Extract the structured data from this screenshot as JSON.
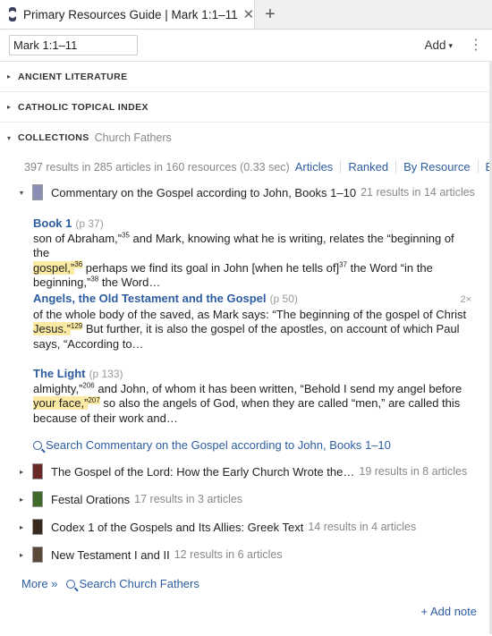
{
  "tab": {
    "title": "Primary Resources Guide | Mark 1:1–11",
    "close": "✕",
    "add": "+"
  },
  "toolbar": {
    "reference": "Mark 1:1–11",
    "add_label": "Add",
    "add_caret": "▾",
    "more": "⋮"
  },
  "sections": [
    {
      "title": "ANCIENT LITERATURE",
      "sub": "",
      "arrow": "▸"
    },
    {
      "title": "CATHOLIC TOPICAL INDEX",
      "sub": "",
      "arrow": "▸"
    },
    {
      "title": "COLLECTIONS",
      "sub": "Church Fathers",
      "arrow": "▾"
    }
  ],
  "results": {
    "count": "397 results in 285 articles in 160 resources (0.33 sec)",
    "views": [
      "Articles",
      "Ranked",
      "By Resource",
      "By"
    ]
  },
  "resources": [
    {
      "arrow": "▾",
      "title": "Commentary on the Gospel according to John, Books 1–10",
      "meta": "21 results in 14 articles",
      "color": "#8a8fb5"
    },
    {
      "arrow": "▸",
      "title": "The Gospel of the Lord: How the Early Church Wrote the…",
      "meta": "19 results in 8 articles",
      "color": "#6b2a2a"
    },
    {
      "arrow": "▸",
      "title": "Festal Orations",
      "meta": "17 results in 3 articles",
      "color": "#3f6b2a"
    },
    {
      "arrow": "▸",
      "title": "Codex 1 of the Gospels and Its Allies: Greek Text",
      "meta": "14 results in 4 articles",
      "color": "#3a2a1e"
    },
    {
      "arrow": "▸",
      "title": "New Testament I and II",
      "meta": "12 results in 6 articles",
      "color": "#5a4a3a"
    }
  ],
  "hits": [
    {
      "title": "Book 1",
      "page": "(p 37)",
      "count": "",
      "l1a": "son of Abraham,”",
      "l1s": "35",
      "l1b": " and Mark, knowing what he is writing, relates the “beginning of the",
      "l2a": "gospel,”",
      "l2s": "36",
      "l2b": " perhaps we find its goal in John [when he tells of]",
      "l2s2": "37",
      "l2c": " the Word “in the",
      "l3a": "beginning,”",
      "l3s": "38",
      "l3b": " the Word…"
    },
    {
      "title": "Angels, the Old Testament and the Gospel",
      "page": "(p 50)",
      "count": "2×",
      "l1a": "of the whole body of the saved, as Mark says: “The beginning of the gospel of Christ",
      "l2a": "Jesus.”",
      "l2s": "129",
      "l2b": " But further, it is also the gospel of the apostles, on account of which Paul",
      "l3a": "says, “According to…"
    },
    {
      "title": "The Light",
      "page": "(p 133)",
      "count": "",
      "l1a": "almighty,”",
      "l1s": "206",
      "l1b": " and John, of whom it has been written, “Behold I send my angel before",
      "l2a": "your face,”",
      "l2s": "207",
      "l2b": " so also the angels of God, when they are called “men,” are called this",
      "l3a": "because of their work and…"
    }
  ],
  "search_resource": "Search Commentary on the Gospel according to John, Books 1–10",
  "footer": {
    "more": "More »",
    "search_collection": "Search Church Fathers",
    "add_note": "+ Add note"
  }
}
